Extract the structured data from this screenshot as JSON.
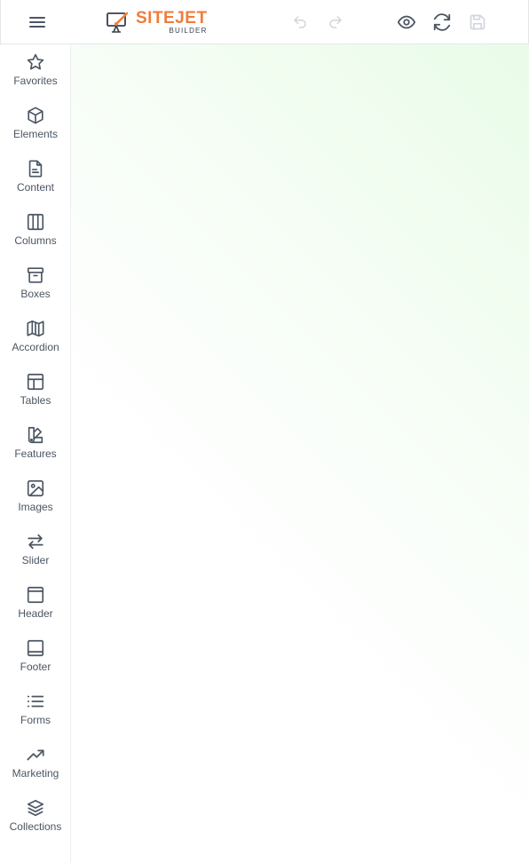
{
  "app": {
    "logo_main": "SITEJET",
    "logo_sub": "BUILDER",
    "brand_color": "#f07c3c"
  },
  "toolbar": {
    "menu_icon": "hamburger-icon",
    "undo_icon": "undo-icon",
    "redo_icon": "redo-icon",
    "preview_icon": "eye-icon",
    "refresh_icon": "refresh-icon",
    "save_icon": "save-icon"
  },
  "sidebar": {
    "items": [
      {
        "label": "Favorites",
        "icon": "star-icon"
      },
      {
        "label": "Elements",
        "icon": "cube-icon"
      },
      {
        "label": "Content",
        "icon": "document-icon"
      },
      {
        "label": "Columns",
        "icon": "columns-icon"
      },
      {
        "label": "Boxes",
        "icon": "archive-box-icon"
      },
      {
        "label": "Accordion",
        "icon": "map-fold-icon"
      },
      {
        "label": "Tables",
        "icon": "table-layout-icon"
      },
      {
        "label": "Features",
        "icon": "swatch-icon"
      },
      {
        "label": "Images",
        "icon": "image-icon"
      },
      {
        "label": "Slider",
        "icon": "arrows-exchange-icon"
      },
      {
        "label": "Header",
        "icon": "header-layout-icon"
      },
      {
        "label": "Footer",
        "icon": "footer-layout-icon"
      },
      {
        "label": "Forms",
        "icon": "list-lines-icon"
      },
      {
        "label": "Marketing",
        "icon": "trending-up-icon"
      },
      {
        "label": "Collections",
        "icon": "stack-layers-icon"
      }
    ]
  },
  "colors": {
    "icon": "#4b5563",
    "icon_disabled": "#d1d5db",
    "canvas_tint": "#e9fce8"
  }
}
